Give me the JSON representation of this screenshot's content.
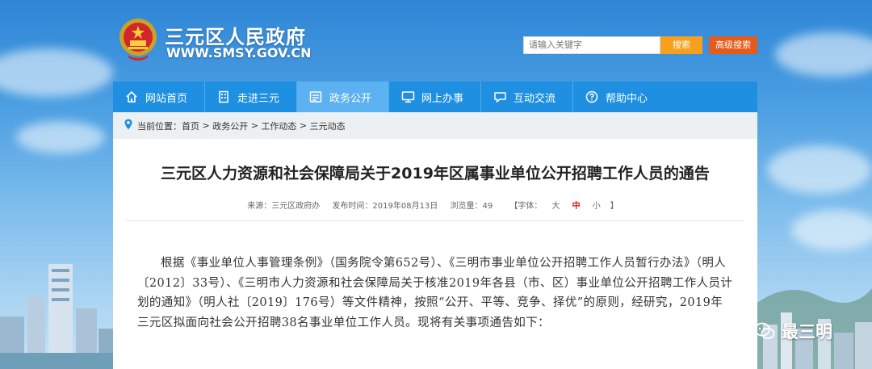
{
  "header": {
    "site_title": "三元区人民政府",
    "site_url": "WWW.SMSY.GOV.CN",
    "emblem_icon": "national-emblem-icon"
  },
  "search": {
    "placeholder": "请输入关键字",
    "button_label": "搜索",
    "advanced_label": "高级搜索"
  },
  "nav": {
    "items": [
      {
        "label": "网站首页",
        "icon": "home-icon"
      },
      {
        "label": "走进三元",
        "icon": "building-icon"
      },
      {
        "label": "政务公开",
        "icon": "folder-icon"
      },
      {
        "label": "网上办事",
        "icon": "monitor-icon"
      },
      {
        "label": "互动交流",
        "icon": "chat-icon"
      },
      {
        "label": "帮助中心",
        "icon": "help-icon"
      }
    ],
    "active_index": 2
  },
  "breadcrumb": {
    "prefix": "当前位置：",
    "items": [
      "首页",
      "政务公开",
      "工作动态",
      "三元动态"
    ],
    "separator": " > "
  },
  "article": {
    "title": "三元区人力资源和社会保障局关于2019年区属事业单位公开招聘工作人员的通告",
    "source": "来源：三元区政府办",
    "published": "发布时间：2019年08月13日",
    "views": "浏览量：49",
    "font_size_label": "【字体：",
    "font_large": "大",
    "font_medium": "中",
    "font_small": "小",
    "font_size_end": "】",
    "body": "根据《事业单位人事管理条例》（国务院令第652号）、《三明市事业单位公开招聘工作人员暂行办法》（明人〔2012〕33号）、《三明市人力资源和社会保障局关于核准2019年各县（市、区）事业单位公开招聘工作人员计划的通知》（明人社〔2019〕176号）等文件精神，按照“公开、平等、竞争、择优”的原则，经研究，2019年三元区拟面向社会公开招聘38名事业单位工作人员。现将有关事项通告如下："
  },
  "watermark": {
    "label": "最三明",
    "icon": "wechat-icon"
  },
  "colors": {
    "nav_bg": "#1e8fe1",
    "nav_active": "#5cb2f0",
    "search_btn": "#f7a01e",
    "advanced_btn": "#e55b1b",
    "font_medium_red": "#d01c1c"
  }
}
